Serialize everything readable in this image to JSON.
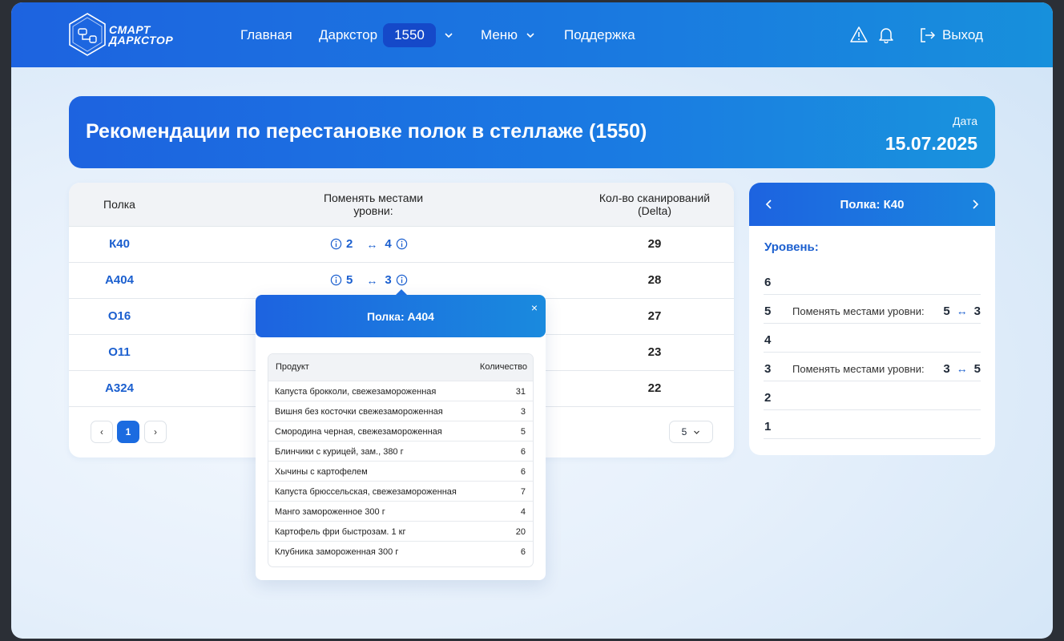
{
  "header": {
    "logo_line1": "СМАРТ",
    "logo_line2": "ДАРКСТОР",
    "nav_home": "Главная",
    "nav_darkstore": "Даркстор",
    "darkstore_value": "1550",
    "nav_menu": "Меню",
    "nav_support": "Поддержка",
    "logout": "Выход",
    "icons": [
      "warning-icon",
      "bell-icon",
      "logout-icon",
      "chevron-down-icon"
    ]
  },
  "banner": {
    "title": "Рекомендации по перестановке полок в стеллаже (1550)",
    "date_label": "Дата",
    "date_value": "15.07.2025"
  },
  "table": {
    "col_shelf": "Полка",
    "col_swap_line1": "Поменять местами",
    "col_swap_line2": "уровни:",
    "col_scans_line1": "Кол-во сканирований",
    "col_scans_line2": "(Delta)",
    "swap_arrow": "↔",
    "rows": [
      {
        "shelf": "К40",
        "from": "2",
        "to": "4",
        "delta": "29"
      },
      {
        "shelf": "А404",
        "from": "5",
        "to": "3",
        "delta": "28"
      },
      {
        "shelf": "О16",
        "from": "",
        "to": "",
        "delta": "27"
      },
      {
        "shelf": "О11",
        "from": "",
        "to": "",
        "delta": "23"
      },
      {
        "shelf": "А324",
        "from": "",
        "to": "",
        "delta": "22"
      }
    ],
    "pager": {
      "prev": "‹",
      "current": "1",
      "next": "›",
      "page_size": "5"
    }
  },
  "side": {
    "title": "Полка: К40",
    "level_label": "Уровень:",
    "levels": [
      {
        "num": "6",
        "text": "",
        "from": "",
        "to": ""
      },
      {
        "num": "5",
        "text": "Поменять местами уровни:",
        "from": "5",
        "to": "3"
      },
      {
        "num": "4",
        "text": "",
        "from": "",
        "to": ""
      },
      {
        "num": "3",
        "text": "Поменять местами уровни:",
        "from": "3",
        "to": "5"
      },
      {
        "num": "2",
        "text": "",
        "from": "",
        "to": ""
      },
      {
        "num": "1",
        "text": "",
        "from": "",
        "to": ""
      }
    ],
    "arrow": "↔"
  },
  "popup": {
    "title": "Полка: А404",
    "close": "×",
    "col_product": "Продукт",
    "col_qty": "Количество",
    "items": [
      {
        "product": "Капуста брокколи, свежезамороженная",
        "qty": "31"
      },
      {
        "product": "Вишня без косточки свежезамороженная",
        "qty": "3"
      },
      {
        "product": "Смородина черная, свежезамороженная",
        "qty": "5"
      },
      {
        "product": "Блинчики с курицей, зам., 380 г",
        "qty": "6"
      },
      {
        "product": "Хычины с картофелем",
        "qty": "6"
      },
      {
        "product": "Капуста брюссельская, свежезамороженная",
        "qty": "7"
      },
      {
        "product": "Манго замороженное 300 г",
        "qty": "4"
      },
      {
        "product": "Картофель фри быстрозам. 1 кг",
        "qty": "20"
      },
      {
        "product": "Клубника замороженная 300 г",
        "qty": "6"
      }
    ]
  },
  "colors": {
    "accent": "#1b5fcf",
    "header_start": "#1d63e0",
    "header_end": "#1790dc"
  }
}
